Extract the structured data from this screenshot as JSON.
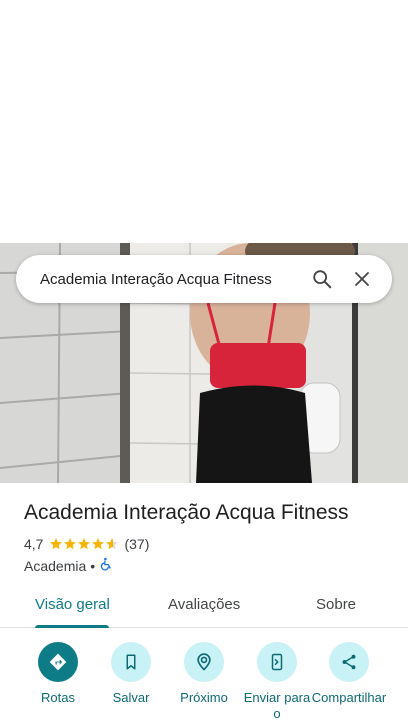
{
  "search": {
    "query": "Academia Interação Acqua Fitness"
  },
  "place": {
    "name": "Academia Interação Acqua Fitness",
    "rating": "4,7",
    "rating_value": 4.7,
    "review_count": "(37)",
    "category": "Academia",
    "separator": "•"
  },
  "tabs": [
    {
      "label": "Visão geral",
      "active": true
    },
    {
      "label": "Avaliações",
      "active": false
    },
    {
      "label": "Sobre",
      "active": false
    }
  ],
  "actions": [
    {
      "label": "Rotas",
      "icon": "directions-icon"
    },
    {
      "label": "Salvar",
      "icon": "bookmark-icon"
    },
    {
      "label": "Próximo",
      "icon": "nearby-icon"
    },
    {
      "label": "Enviar para o",
      "icon": "send-to-phone-icon"
    },
    {
      "label": "Compartilhar",
      "icon": "share-icon"
    }
  ],
  "colors": {
    "accent": "#0e7c86",
    "action_bg": "#c8f2f5",
    "star": "#f5b400",
    "accessibility": "#1a73e8"
  }
}
